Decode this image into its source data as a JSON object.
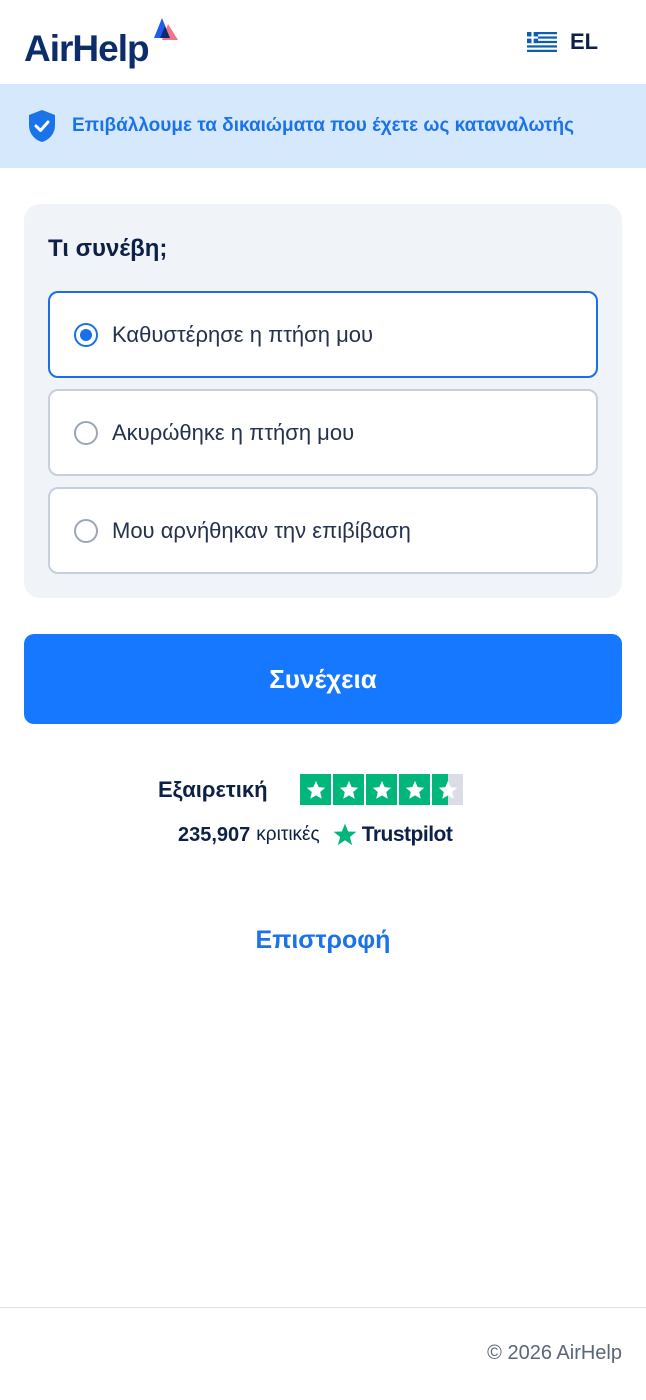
{
  "header": {
    "logo_text": "AirHelp",
    "language_code": "EL",
    "flag_icon": "greece-flag-icon"
  },
  "banner": {
    "icon": "shield-check-icon",
    "text": "Επιβάλλουμε τα δικαιώματα που έχετε ως καταναλωτής"
  },
  "question": {
    "title": "Τι συνέβη;",
    "options": [
      {
        "label": "Καθυστέρησε η πτήση μου",
        "selected": true
      },
      {
        "label": "Ακυρώθηκε η πτήση μου",
        "selected": false
      },
      {
        "label": "Μου αρνήθηκαν την επιβίβαση",
        "selected": false
      }
    ]
  },
  "continue_label": "Συνέχεια",
  "trustpilot": {
    "rating_word": "Εξαιρετική",
    "stars": 4.5,
    "review_count": "235,907",
    "reviews_label": "κριτικές",
    "brand": "Trustpilot",
    "star_color": "#00b67a"
  },
  "back_label": "Επιστροφή",
  "footer": {
    "copyright": "© 2026 AirHelp"
  },
  "colors": {
    "brand_navy": "#0d2147",
    "accent_blue": "#1677ff",
    "banner_bg": "#d6e8fb"
  }
}
